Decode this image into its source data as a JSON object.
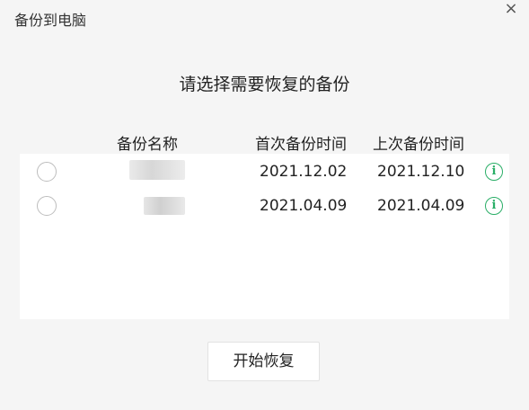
{
  "window": {
    "title": "备份到电脑",
    "close_glyph": "×"
  },
  "heading": "请选择需要恢复的备份",
  "columns": {
    "name": "备份名称",
    "first_backup": "首次备份时间",
    "last_backup": "上次备份时间"
  },
  "backups": [
    {
      "selected": false,
      "first_backup": "2021.12.02",
      "last_backup": "2021.12.10",
      "info_icon": "info-icon"
    },
    {
      "selected": false,
      "first_backup": "2021.04.09",
      "last_backup": "2021.04.09",
      "info_icon": "info-icon"
    }
  ],
  "actions": {
    "restore_label": "开始恢复"
  },
  "colors": {
    "accent": "#2aae67",
    "panel": "#ffffff",
    "background": "#f5f5f5"
  }
}
